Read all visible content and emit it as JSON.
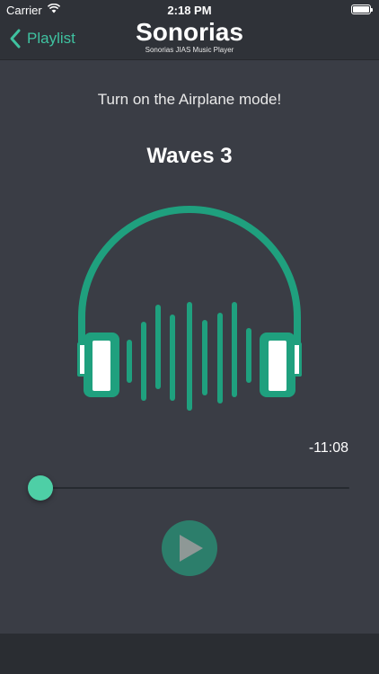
{
  "status_bar": {
    "carrier": "Carrier",
    "time": "2:18 PM",
    "icons": [
      "wifi-icon",
      "battery-icon"
    ]
  },
  "nav": {
    "back_label": "Playlist",
    "title": "Sonorias",
    "subtitle": "Sonorias JIAS Music Player"
  },
  "player": {
    "notice": "Turn on the Airplane mode!",
    "track_title": "Waves 3",
    "artwork_icon": "headphones-soundwave-icon",
    "remaining_time": "-11:08",
    "progress": 0.0,
    "play_icon": "play-icon"
  },
  "colors": {
    "accent": "#1fa07e",
    "thumb": "#4ecfa6",
    "background": "#3a3d45",
    "nav_background": "#2f3238",
    "play_button": "#2c7e6b"
  }
}
